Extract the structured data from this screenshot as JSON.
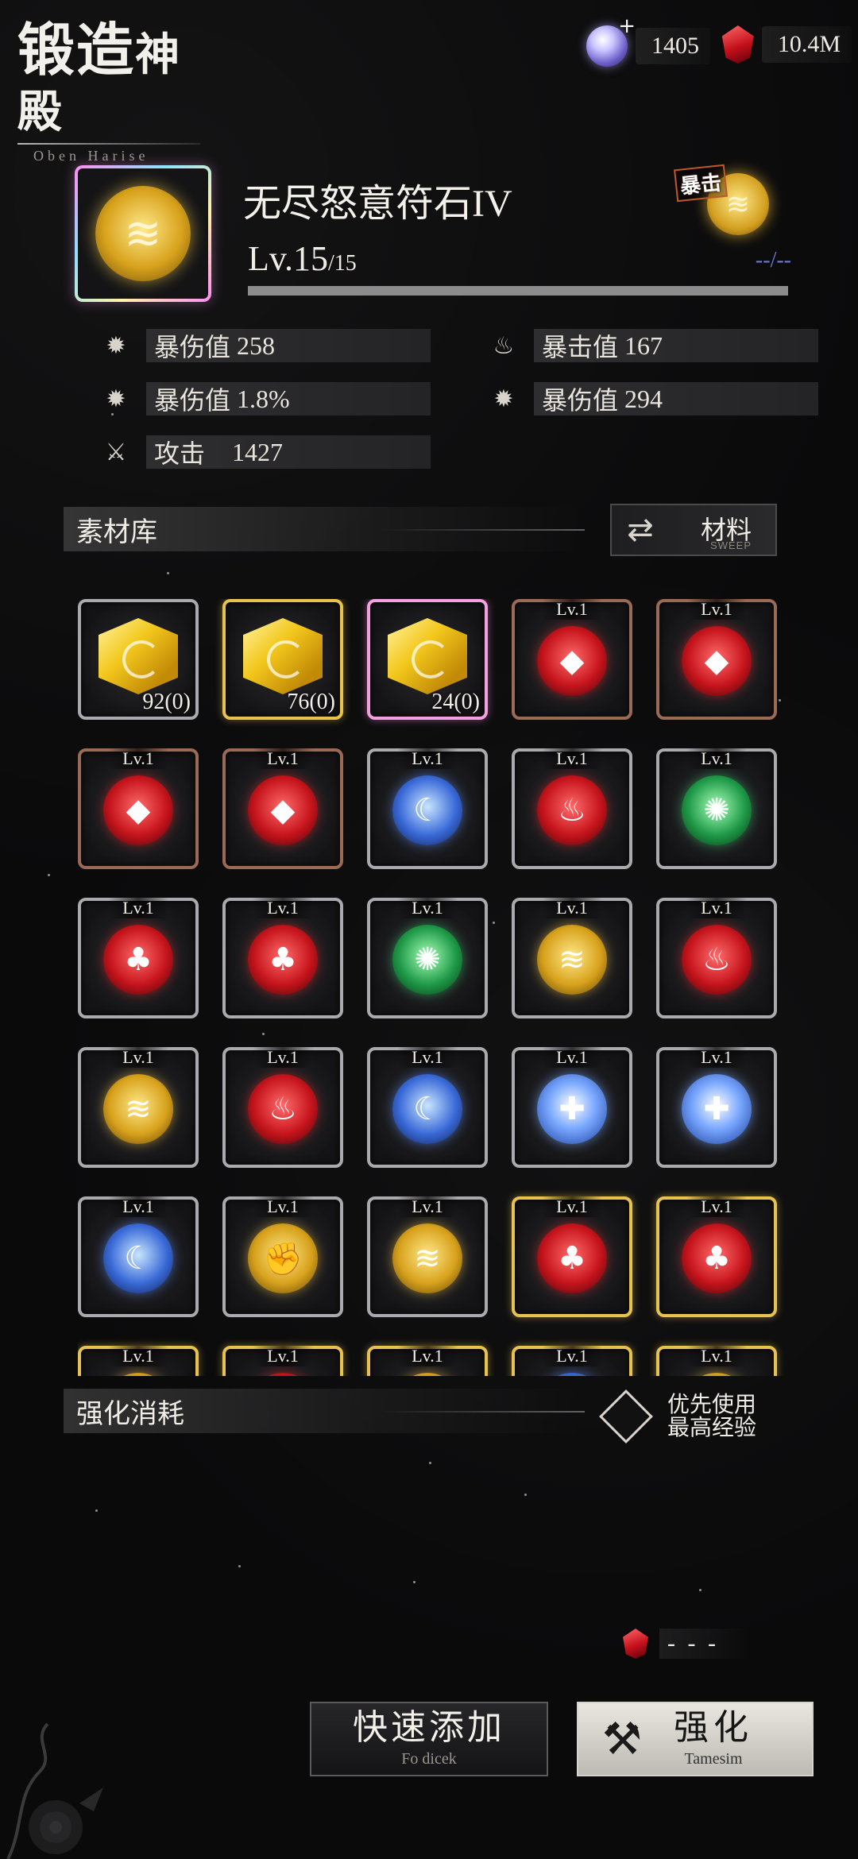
{
  "header": {
    "title_a": "锻造",
    "title_b": "神殿",
    "subtitle": "Oben Harise"
  },
  "currency": {
    "crystal_value": "1405",
    "ruby_value": "10.4M"
  },
  "item": {
    "name": "无尽怒意符石IV",
    "level_label": "Lv.15",
    "level_max": "/15",
    "exp_text": "--/--",
    "exp_fraction": 1.0,
    "tag_label": "暴击",
    "icon": "claw-icon"
  },
  "stats": [
    {
      "icon": "burst-icon",
      "label": "暴伤值",
      "value": "258"
    },
    {
      "icon": "flame-icon",
      "label": "暴击值",
      "value": "167"
    },
    {
      "icon": "burst-icon",
      "label": "暴伤值",
      "value": "1.8%"
    },
    {
      "icon": "burst-icon",
      "label": "暴伤值",
      "value": "294"
    },
    {
      "icon": "sword-icon",
      "label": "攻击",
      "value": "1427"
    }
  ],
  "materials": {
    "section_title": "素材库",
    "sort_label": "材料",
    "sort_sub": "SWEEP",
    "items": [
      {
        "type": "cube",
        "frame": "silver",
        "count": "92(0)"
      },
      {
        "type": "cube",
        "frame": "gold",
        "count": "76(0)"
      },
      {
        "type": "cube",
        "frame": "pink",
        "count": "24(0)"
      },
      {
        "type": "rune",
        "frame": "bronze",
        "color": "red",
        "glyph": "◆",
        "level": "Lv.1"
      },
      {
        "type": "rune",
        "frame": "bronze",
        "color": "red",
        "glyph": "◆",
        "level": "Lv.1"
      },
      {
        "type": "rune",
        "frame": "bronze",
        "color": "red",
        "glyph": "◆",
        "level": "Lv.1"
      },
      {
        "type": "rune",
        "frame": "bronze",
        "color": "red",
        "glyph": "◆",
        "level": "Lv.1"
      },
      {
        "type": "rune",
        "frame": "silver",
        "color": "blue",
        "glyph": "☾",
        "level": "Lv.1"
      },
      {
        "type": "rune",
        "frame": "silver",
        "color": "red",
        "glyph": "♨",
        "level": "Lv.1"
      },
      {
        "type": "rune",
        "frame": "silver",
        "color": "green",
        "glyph": "✺",
        "level": "Lv.1"
      },
      {
        "type": "rune",
        "frame": "silver",
        "color": "red",
        "glyph": "♣",
        "level": "Lv.1"
      },
      {
        "type": "rune",
        "frame": "silver",
        "color": "red",
        "glyph": "♣",
        "level": "Lv.1"
      },
      {
        "type": "rune",
        "frame": "silver",
        "color": "green",
        "glyph": "✺",
        "level": "Lv.1"
      },
      {
        "type": "rune",
        "frame": "silver",
        "color": "gold",
        "glyph": "≋",
        "level": "Lv.1"
      },
      {
        "type": "rune",
        "frame": "silver",
        "color": "red",
        "glyph": "♨",
        "level": "Lv.1"
      },
      {
        "type": "rune",
        "frame": "silver",
        "color": "gold",
        "glyph": "≋",
        "level": "Lv.1"
      },
      {
        "type": "rune",
        "frame": "silver",
        "color": "red",
        "glyph": "♨",
        "level": "Lv.1"
      },
      {
        "type": "rune",
        "frame": "silver",
        "color": "blue",
        "glyph": "☾",
        "level": "Lv.1"
      },
      {
        "type": "rune",
        "frame": "silver",
        "color": "frost",
        "glyph": "✚",
        "level": "Lv.1"
      },
      {
        "type": "rune",
        "frame": "silver",
        "color": "frost",
        "glyph": "✚",
        "level": "Lv.1"
      },
      {
        "type": "rune",
        "frame": "silver",
        "color": "blue",
        "glyph": "☾",
        "level": "Lv.1"
      },
      {
        "type": "rune",
        "frame": "silver",
        "color": "gold",
        "glyph": "✊",
        "level": "Lv.1"
      },
      {
        "type": "rune",
        "frame": "silver",
        "color": "gold",
        "glyph": "≋",
        "level": "Lv.1"
      },
      {
        "type": "rune",
        "frame": "gold",
        "color": "red",
        "glyph": "♣",
        "level": "Lv.1"
      },
      {
        "type": "rune",
        "frame": "gold",
        "color": "red",
        "glyph": "♣",
        "level": "Lv.1"
      },
      {
        "type": "rune",
        "frame": "gold",
        "color": "gold",
        "glyph": "≋",
        "level": "Lv.1"
      },
      {
        "type": "rune",
        "frame": "gold",
        "color": "red",
        "glyph": "♨",
        "level": "Lv.1"
      },
      {
        "type": "rune",
        "frame": "gold",
        "color": "gold",
        "glyph": "≋",
        "level": "Lv.1"
      },
      {
        "type": "rune",
        "frame": "gold",
        "color": "blue",
        "glyph": "☾",
        "level": "Lv.1"
      },
      {
        "type": "rune",
        "frame": "gold",
        "color": "gold",
        "glyph": "≋",
        "level": "Lv.1"
      }
    ]
  },
  "enhance": {
    "section_title": "强化消耗",
    "toggle_label_1": "优先使用",
    "toggle_label_2": "最高经验",
    "cost_value": "- - -"
  },
  "buttons": {
    "quick_add": "快速添加",
    "quick_add_sub": "Fo dicek",
    "enhance": "强化",
    "enhance_sub": "Tamesim"
  }
}
